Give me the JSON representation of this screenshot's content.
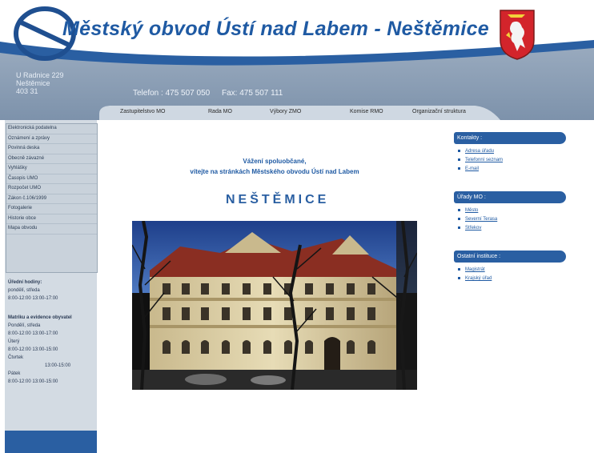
{
  "header": {
    "title": "Městský obvod Ústí nad Labem - Neštěmice",
    "address": [
      "U Radnice 229",
      "Neštěmice",
      "403 31"
    ],
    "phone": "Telefon : 475 507 050",
    "fax": "Fax: 475 507 111"
  },
  "top_nav": [
    "Zastupitelstvo MO",
    "Rada MO",
    "Výbory ZMO",
    "Komise RMO",
    "Organizační struktura"
  ],
  "sidebar": {
    "menu": [
      "Elektronická podatelna",
      "Oznámení a zprávy",
      "Povinná deska",
      "Obecně závazné",
      "Vyhlášky",
      "Časopis UMO",
      "Rozpočet UMO",
      "Zákon č.106/1999",
      "Fotogalerie",
      "Historie obce",
      "Mapa obvodu"
    ],
    "hours_title": "Úřední hodiny:",
    "hours_lines": [
      "pondělí, středa",
      "8:00-12:00  13:00-17:00"
    ],
    "evidence_title": "Matriku a evidence obyvatel",
    "evidence_lines": [
      "Pondělí, středa",
      "8:00-12:00  13:00-17:00",
      "Úterý",
      "8:00-12:00  13:00-15:00",
      "Čtvrtek",
      "13:00-15:00",
      "Pátek",
      "8:00-12:00  13:00-15:00"
    ]
  },
  "main": {
    "welcome_line1": "Vážení spoluobčané,",
    "welcome_line2": "vítejte na stránkách Městského obvodu Ústí nad Labem",
    "town_name": "NEŠTĚMICE"
  },
  "right": {
    "contacts_title": "Kontakty :",
    "contacts": [
      "Adresa úřadu",
      "Telefonní seznam",
      "E-mail"
    ],
    "offices_title": "Úřady MO :",
    "offices": [
      "Město",
      "Severní Terasa",
      "Střekov"
    ],
    "other_title": "Ostatní instituce :",
    "other": [
      "Magistrát",
      "Krajský úřad"
    ]
  },
  "colors": {
    "brand_blue": "#2a5fa2",
    "header_gray": "#8c9eb5",
    "sidebar_bg": "#d3dbe3"
  },
  "icons": [
    "coat-of-arms-icon",
    "ring-logo-icon"
  ]
}
